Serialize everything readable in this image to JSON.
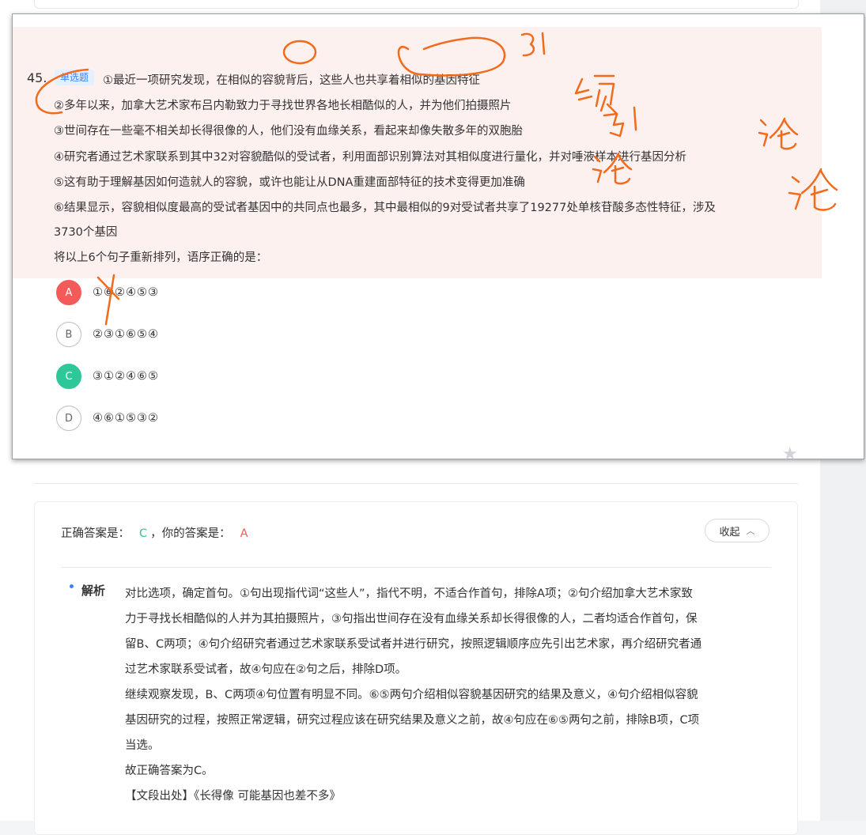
{
  "question": {
    "number": "45.",
    "type_tag": "单选题",
    "stem_lines": [
      "①最近一项研究发现，在相似的容貌背后，这些人也共享着相似的基因特征",
      "②多年以来，加拿大艺术家布吕内勒致力于寻找世界各地长相酷似的人，并为他们拍摄照片",
      "③世间存在一些毫不相关却长得很像的人，他们没有血缘关系，看起来却像失散多年的双胞胎",
      "④研究者通过艺术家联系到其中32对容貌酷似的受试者，利用面部识别算法对其相似度进行量化，并对唾液样本进行基因分析",
      "⑤这有助于理解基因如何造就人的容貌，或许也能让从DNA重建面部特征的技术变得更加准确",
      "⑥结果显示，容貌相似度最高的受试者基因中的共同点也最多，其中最相似的9对受试者共享了19277处单核苷酸多态性特征，涉及",
      "3730个基因",
      "将以上6个句子重新排列，语序正确的是："
    ],
    "options": [
      {
        "letter": "A",
        "text": "①⑥②④⑤③",
        "state": "wrong"
      },
      {
        "letter": "B",
        "text": "②③①⑥⑤④",
        "state": "normal"
      },
      {
        "letter": "C",
        "text": "③①②④⑥⑤",
        "state": "correct"
      },
      {
        "letter": "D",
        "text": "④⑥①⑤③②",
        "state": "normal"
      }
    ],
    "star_icon": "star-icon"
  },
  "handwriting": {
    "color": "#f26a1b",
    "notes": [
      "31",
      "领",
      "引",
      "论",
      "论",
      "论",
      "X"
    ]
  },
  "answer": {
    "correct_label": "正确答案是：",
    "correct_value": "C",
    "separator": "，",
    "yours_label": "你的答案是：",
    "yours_value": "A",
    "collapse_label": "收起",
    "analysis_label": "解析",
    "analysis_lines": [
      "对比选项，确定首句。①句出现指代词“这些人”，指代不明，不适合作首句，排除A项；②句介绍加拿大艺术家致",
      "力于寻找长相酷似的人并为其拍摄照片，③句指出世间存在没有血缘关系却长得很像的人，二者均适合作首句，保",
      "留B、C两项；④句介绍研究者通过艺术家联系受试者并进行研究，按照逻辑顺序应先引出艺术家，再介绍研究者通",
      "过艺术家联系受试者，故④句应在②句之后，排除D项。",
      "继续观察发现，B、C两项④句位置有明显不同。⑥⑤两句介绍相似容貌基因研究的结果及意义，④句介绍相似容貌",
      "基因研究的过程，按照正常逻辑，研究过程应该在研究结果及意义之前，故④句应在⑥⑤两句之前，排除B项，C项",
      "当选。",
      "故正确答案为C。",
      "【文段出处】《长得像 可能基因也差不多》"
    ]
  },
  "colors": {
    "wrong": "#f55a5a",
    "correct": "#2ec79a",
    "accent": "#3b82f6",
    "stem_bg": "#fdf1f0"
  }
}
